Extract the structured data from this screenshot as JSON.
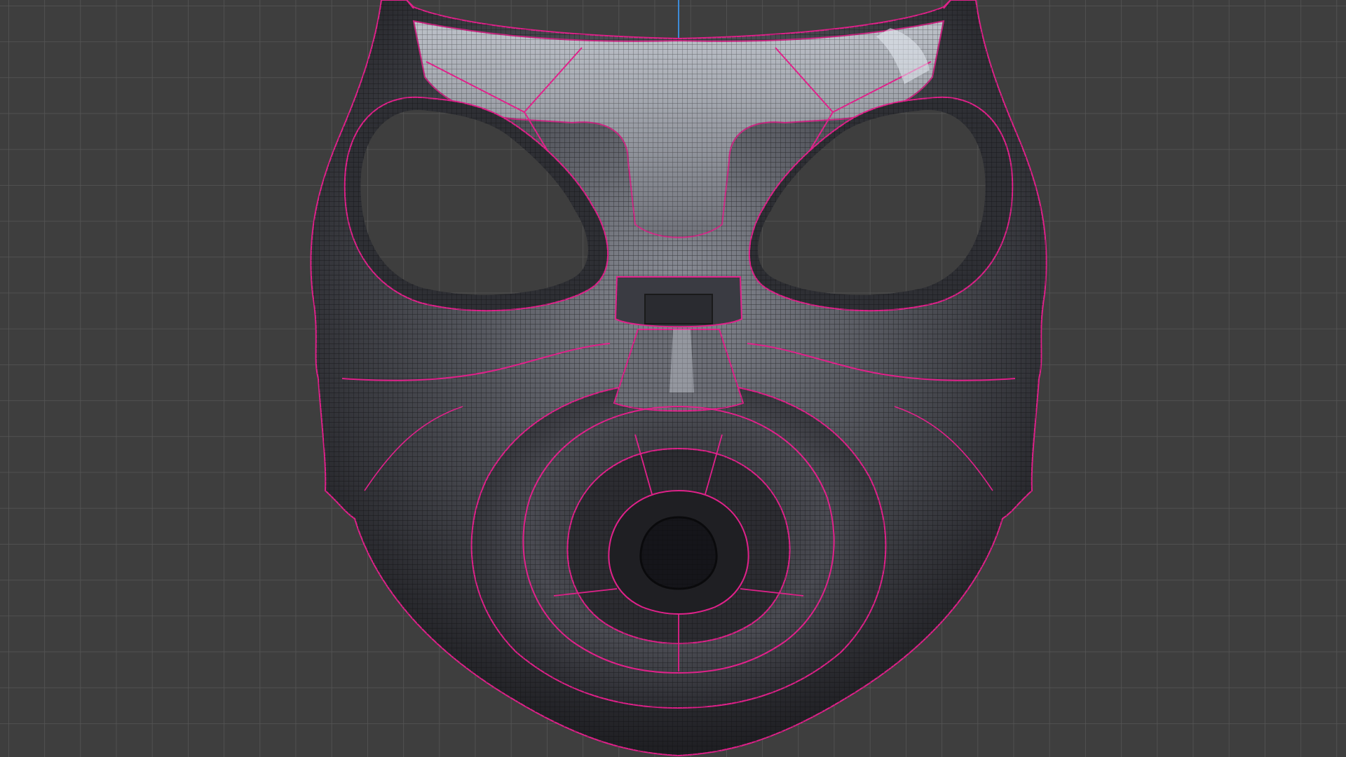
{
  "viewport": {
    "view": "front-orthographic",
    "object": "gas-mask-mesh",
    "display_mode": "wireframe-overlay",
    "colors": {
      "background": "#3e3e3e",
      "grid_minor": "#565656",
      "axis_line": "#3d8bd8",
      "mesh_dark": "#1c1c20",
      "mesh_mid": "#5e5e66",
      "mesh_light": "#c4cad4",
      "seam": "#e0218a"
    }
  }
}
